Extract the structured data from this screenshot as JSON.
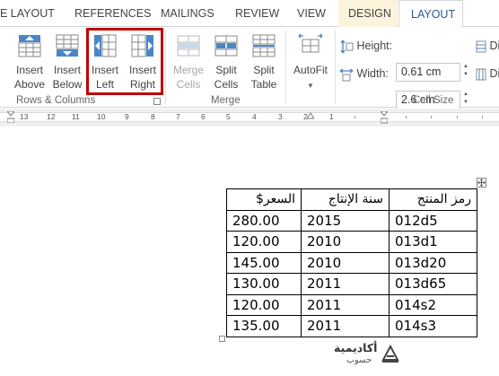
{
  "tabs": [
    {
      "label": "E LAYOUT"
    },
    {
      "label": "REFERENCES"
    },
    {
      "label": "MAILINGS"
    },
    {
      "label": "REVIEW"
    },
    {
      "label": "VIEW"
    },
    {
      "label": "DESIGN"
    },
    {
      "label": "LAYOUT"
    }
  ],
  "ribbon": {
    "rows_columns": {
      "label": "Rows & Columns",
      "insert_above": [
        "Insert",
        "Above"
      ],
      "insert_below": [
        "Insert",
        "Below"
      ],
      "insert_left": [
        "Insert",
        "Left"
      ],
      "insert_right": [
        "Insert",
        "Right"
      ]
    },
    "merge": {
      "label": "Merge",
      "merge_cells": [
        "Merge",
        "Cells"
      ],
      "split_cells": [
        "Split",
        "Cells"
      ],
      "split_table": [
        "Split",
        "Table"
      ]
    },
    "autofit": {
      "label": "AutoFit"
    },
    "cell_size": {
      "label": "Cell Size",
      "height_label": "Height:",
      "height_value": "0.61 cm",
      "width_label": "Width:",
      "width_value": "2.6 cm",
      "dist_label": "Di"
    }
  },
  "ruler": {
    "numbers": [
      "13",
      "12",
      "11",
      "10",
      "9",
      "8",
      "7",
      "6",
      "5",
      "4",
      "3",
      "2",
      "1"
    ]
  },
  "table": {
    "headers": [
      "رمز المنتج",
      "سنة الإنتاج",
      "السعر$"
    ],
    "rows": [
      [
        "012d5",
        "2015",
        "280.00"
      ],
      [
        "013d1",
        "2010",
        "120.00"
      ],
      [
        "013d20",
        "2010",
        "145.00"
      ],
      [
        "013d65",
        "2011",
        "130.00"
      ],
      [
        "014s2",
        "2011",
        "120.00"
      ],
      [
        "014s3",
        "2011",
        "135.00"
      ]
    ]
  },
  "logo": {
    "line1": "أكاديمية",
    "line2": "حسوب"
  },
  "colors": {
    "accent": "#2b579a",
    "highlight": "#c00000",
    "icon_blue": "#4a86c8",
    "design_tab_bg": "#fbf3dc"
  }
}
